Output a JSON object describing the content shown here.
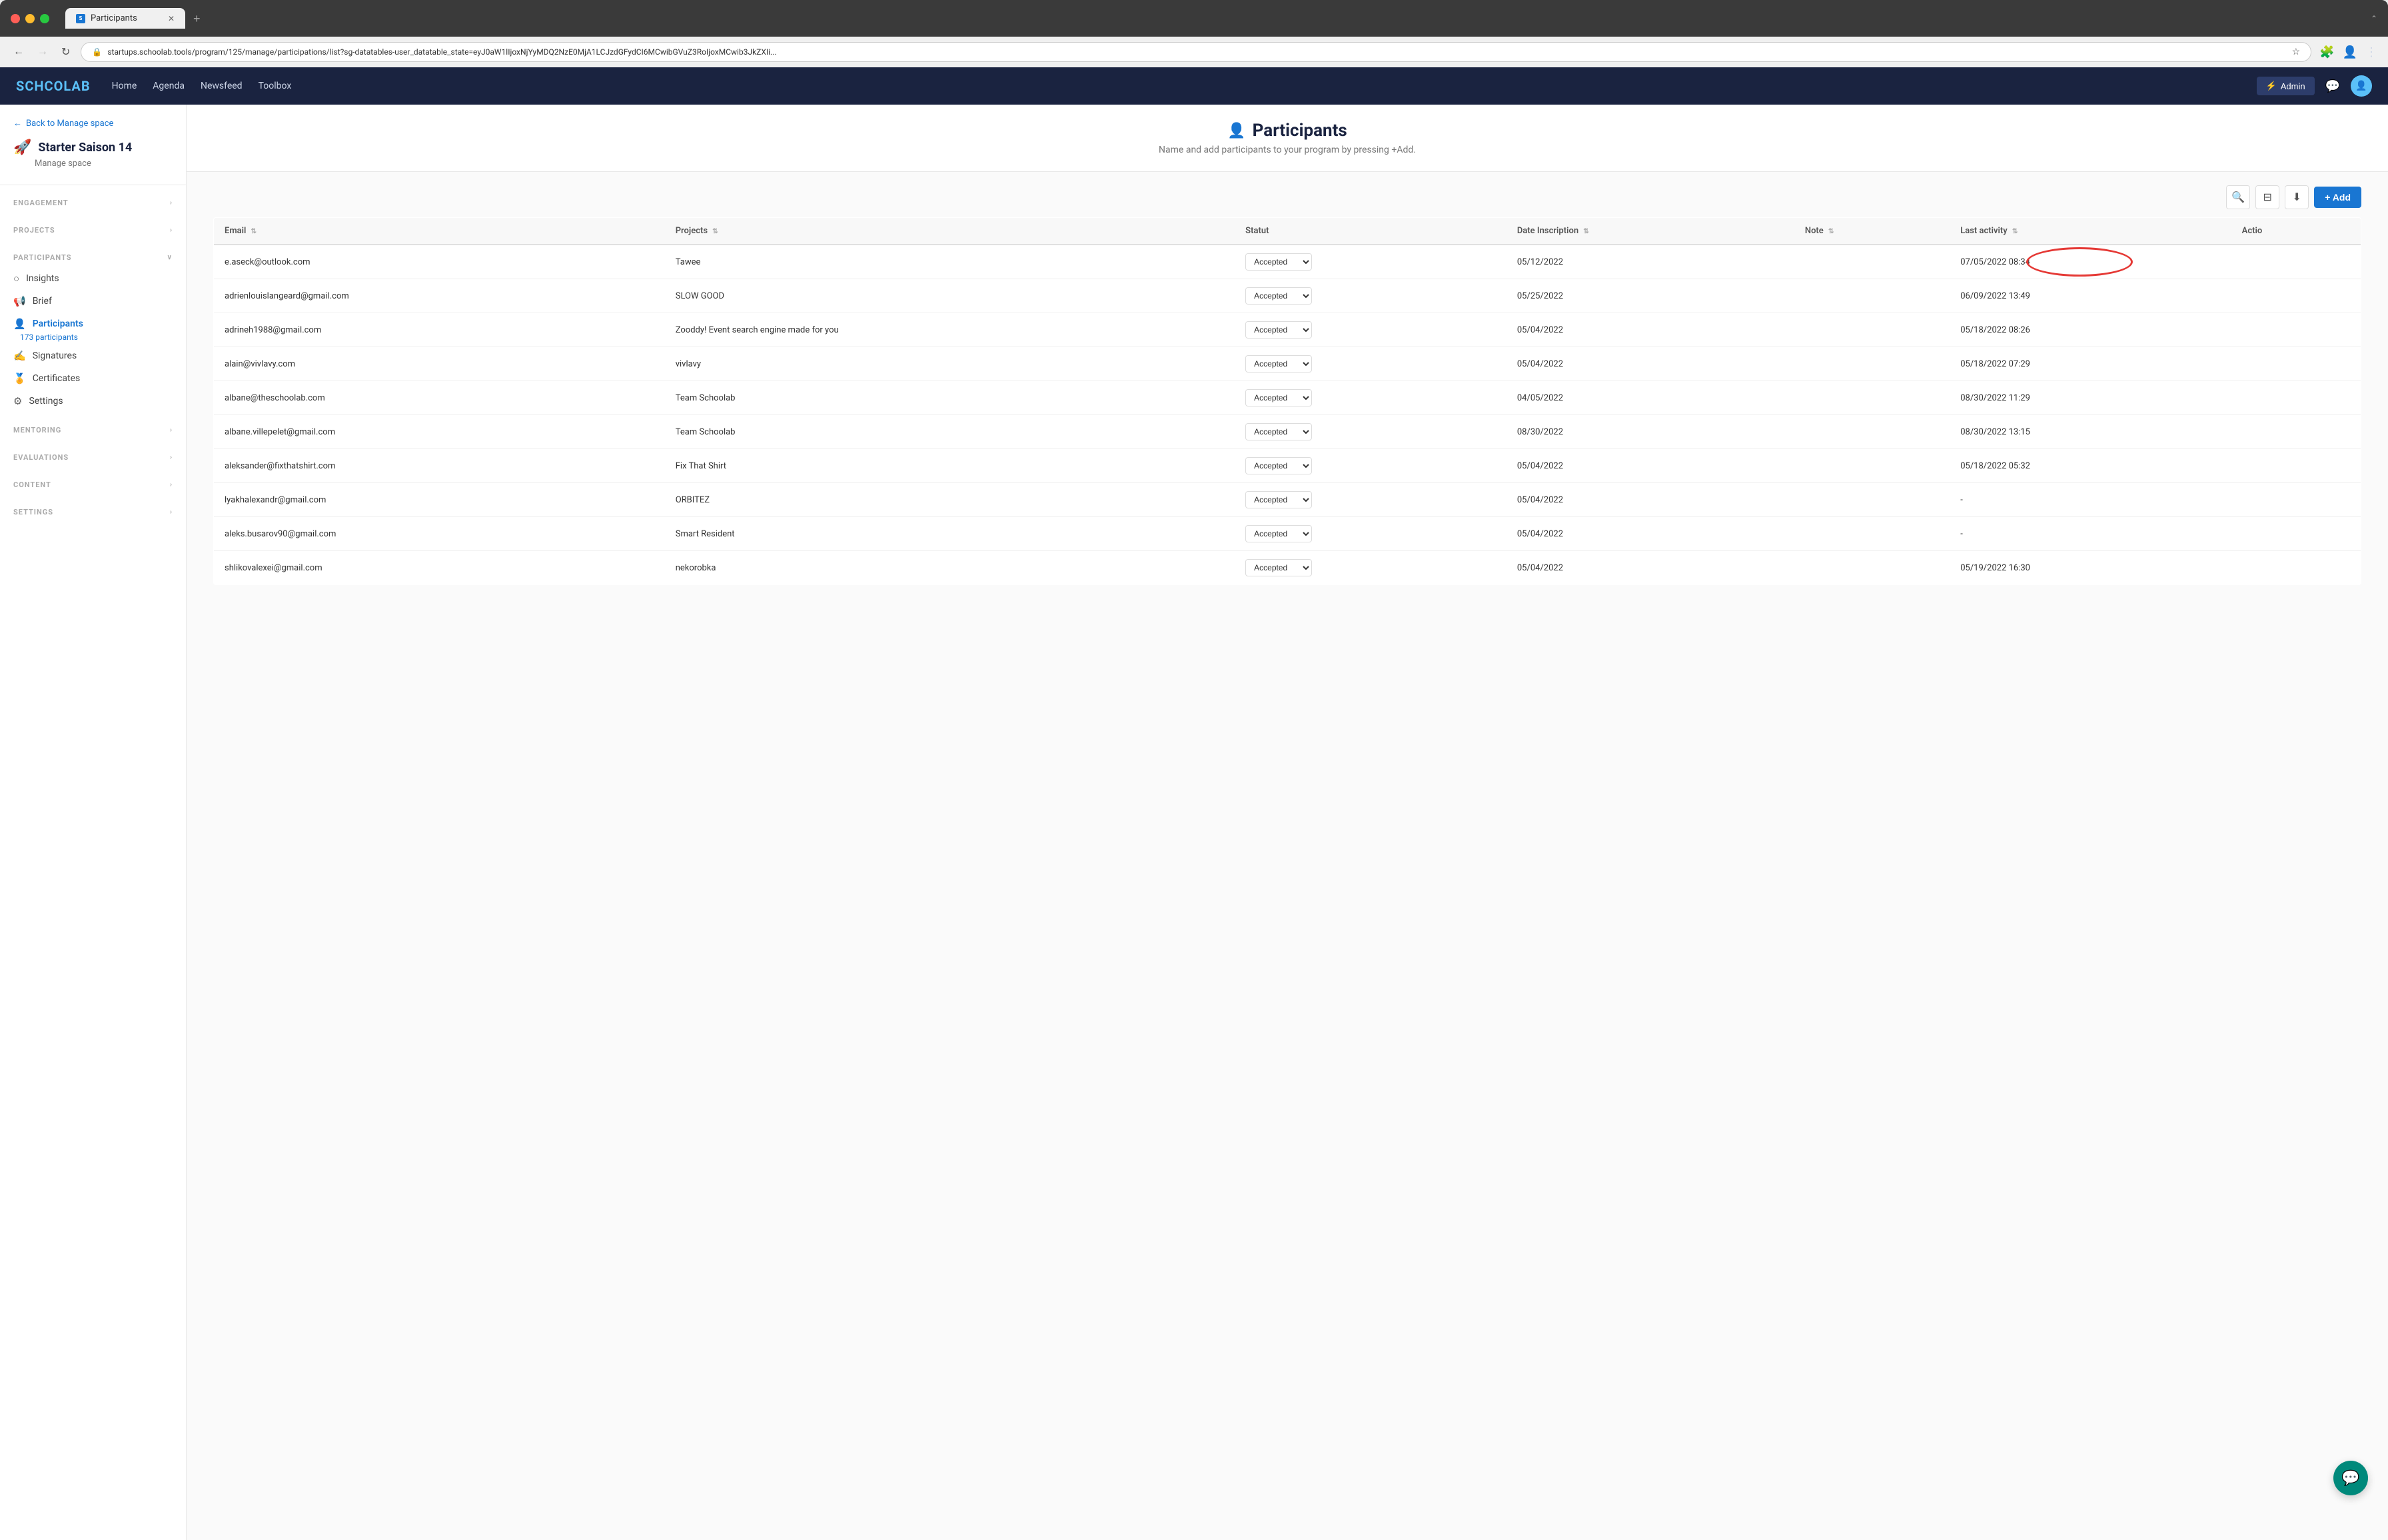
{
  "browser": {
    "tab_label": "Participants",
    "tab_favicon": "S",
    "url": "startups.schoolab.tools/program/125/manage/participations/list?sg-datatables-user_datatable_state=eyJ0aW1lIjoxNjYyMDQ2NzE0MjA1LCJzdGFydCI6MCwibGVuZ3RoIjoxMCwib3JkZXIi...",
    "new_tab_label": "+"
  },
  "nav": {
    "logo": "SCHCOLAB",
    "links": [
      "Home",
      "Agenda",
      "Newsfeed",
      "Toolbox"
    ],
    "admin_label": "Admin"
  },
  "sidebar": {
    "back_label": "Back to Manage space",
    "space_icon": "🚀",
    "space_name": "Starter Saison 14",
    "space_subtitle": "Manage space",
    "sections": [
      {
        "label": "ENGAGEMENT",
        "expandable": true,
        "items": []
      },
      {
        "label": "PROJECTS",
        "expandable": true,
        "items": []
      },
      {
        "label": "PARTICIPANTS",
        "expandable": false,
        "items": [
          {
            "icon": "○",
            "label": "Insights",
            "active": false
          },
          {
            "icon": "📢",
            "label": "Brief",
            "active": false
          },
          {
            "icon": "👤",
            "label": "Participants",
            "active": true,
            "count": "173 participants"
          },
          {
            "icon": "✍",
            "label": "Signatures",
            "active": false
          },
          {
            "icon": "🏅",
            "label": "Certificates",
            "active": false
          },
          {
            "icon": "⚙",
            "label": "Settings",
            "active": false
          }
        ]
      },
      {
        "label": "MENTORING",
        "expandable": true,
        "items": []
      },
      {
        "label": "EVALUATIONS",
        "expandable": true,
        "items": []
      },
      {
        "label": "CONTENT",
        "expandable": true,
        "items": []
      },
      {
        "label": "SETTINGS",
        "expandable": true,
        "items": []
      }
    ]
  },
  "page": {
    "title": "Participants",
    "title_icon": "👤",
    "subtitle": "Name and add participants to your program by pressing +Add."
  },
  "toolbar": {
    "search_icon": "🔍",
    "filter_icon": "⊟",
    "download_icon": "⬇",
    "add_label": "+ Add"
  },
  "table": {
    "columns": [
      {
        "label": "Email",
        "sortable": true
      },
      {
        "label": "Projects",
        "sortable": true
      },
      {
        "label": "Statut",
        "sortable": false
      },
      {
        "label": "Date Inscription",
        "sortable": true
      },
      {
        "label": "Note",
        "sortable": true
      },
      {
        "label": "Last activity",
        "sortable": true
      },
      {
        "label": "Actio",
        "sortable": false
      }
    ],
    "rows": [
      {
        "email": "e.aseck@outlook.com",
        "project": "Tawee",
        "statut": "Accepted",
        "date_inscription": "05/12/2022",
        "note": "",
        "last_activity": "07/05/2022 08:34",
        "highlighted": true
      },
      {
        "email": "adrienlouislangeard@gmail.com",
        "project": "SLOW GOOD",
        "statut": "Accepted",
        "date_inscription": "05/25/2022",
        "note": "",
        "last_activity": "06/09/2022 13:49",
        "highlighted": false
      },
      {
        "email": "adrineh1988@gmail.com",
        "project": "Zooddy! Event search engine made for you",
        "statut": "Accepted",
        "date_inscription": "05/04/2022",
        "note": "",
        "last_activity": "05/18/2022 08:26",
        "highlighted": false
      },
      {
        "email": "alain@vivlavy.com",
        "project": "vivlavy",
        "statut": "Accepted",
        "date_inscription": "05/04/2022",
        "note": "",
        "last_activity": "05/18/2022 07:29",
        "highlighted": false
      },
      {
        "email": "albane@theschoolab.com",
        "project": "Team Schoolab",
        "statut": "Accepted",
        "date_inscription": "04/05/2022",
        "note": "",
        "last_activity": "08/30/2022 11:29",
        "highlighted": false
      },
      {
        "email": "albane.villepelet@gmail.com",
        "project": "Team Schoolab",
        "statut": "Accepted",
        "date_inscription": "08/30/2022",
        "note": "",
        "last_activity": "08/30/2022 13:15",
        "highlighted": false
      },
      {
        "email": "aleksander@fixthatshirt.com",
        "project": "Fix That Shirt",
        "statut": "Accepted",
        "date_inscription": "05/04/2022",
        "note": "",
        "last_activity": "05/18/2022 05:32",
        "highlighted": false
      },
      {
        "email": "lyakhalexandr@gmail.com",
        "project": "ORBITEZ",
        "statut": "Accepted",
        "date_inscription": "05/04/2022",
        "note": "",
        "last_activity": "-",
        "highlighted": false
      },
      {
        "email": "aleks.busarov90@gmail.com",
        "project": "Smart Resident",
        "statut": "Accepted",
        "date_inscription": "05/04/2022",
        "note": "",
        "last_activity": "-",
        "highlighted": false
      },
      {
        "email": "shlikovalexei@gmail.com",
        "project": "nekorobka",
        "statut": "Accepted",
        "date_inscription": "05/04/2022",
        "note": "",
        "last_activity": "05/19/2022 16:30",
        "highlighted": false
      }
    ]
  }
}
